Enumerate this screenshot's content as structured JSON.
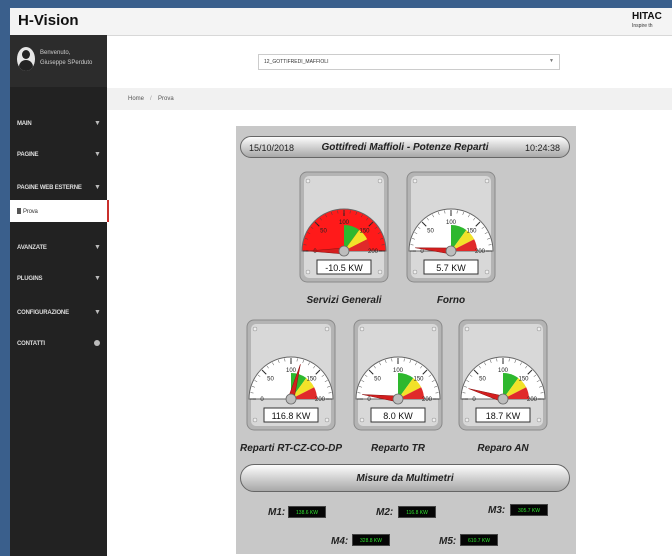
{
  "app": {
    "title": "H-Vision",
    "brand": "HITAC",
    "brand_sub": "Inspire th"
  },
  "user": {
    "greeting": "Benvenuto,",
    "name": "Giuseppe SPerduto"
  },
  "sidebar": {
    "items": [
      {
        "label": "MAIN",
        "icon": "chevron-down-icon"
      },
      {
        "label": "PAGINE",
        "icon": "chevron-down-icon"
      },
      {
        "label": "PAGINE WEB ESTERNE",
        "icon": "chevron-down-icon"
      },
      {
        "label": "Prova",
        "icon": "document-icon",
        "active": true
      },
      {
        "label": "AVANZATE",
        "icon": "chevron-down-icon"
      },
      {
        "label": "PLUGINS",
        "icon": "chevron-down-icon"
      },
      {
        "label": "CONFIGURAZIONE",
        "icon": "chevron-down-icon"
      },
      {
        "label": "CONTATTI",
        "icon": "globe-icon"
      }
    ]
  },
  "selector": {
    "value": "12_GOTTIFREDI_MAFFIOLI"
  },
  "breadcrumb": {
    "home": "Home",
    "sep": "/",
    "current": "Prova"
  },
  "header": {
    "date": "15/10/2018",
    "title": "Gottifredi Maffioli - Potenze Reparti",
    "time": "10:24:38"
  },
  "gauges": [
    {
      "label": "Servizi Generali",
      "value": -10.5,
      "display": "-10.5 KW",
      "min": 0,
      "max": 200,
      "ticks": [
        "0",
        "50",
        "100",
        "150",
        "200"
      ],
      "face": "#ff1a1a"
    },
    {
      "label": "Forno",
      "value": 5.7,
      "display": "5.7 KW",
      "min": 0,
      "max": 200,
      "ticks": [
        "0",
        "50",
        "100",
        "150",
        "200"
      ],
      "face": "#ffffff"
    },
    {
      "label": "Reparti RT-CZ-CO-DP",
      "value": 116.8,
      "display": "116.8 KW",
      "min": 0,
      "max": 200,
      "ticks": [
        "0",
        "50",
        "100",
        "150",
        "200"
      ],
      "face": "#ffffff"
    },
    {
      "label": "Reparto TR",
      "value": 8.0,
      "display": "8.0 KW",
      "min": 0,
      "max": 200,
      "ticks": [
        "0",
        "50",
        "100",
        "150",
        "200"
      ],
      "face": "#ffffff"
    },
    {
      "label": "Reparo AN",
      "value": 18.7,
      "display": "18.7 KW",
      "min": 0,
      "max": 200,
      "ticks": [
        "0",
        "50",
        "100",
        "150",
        "200"
      ],
      "face": "#ffffff"
    }
  ],
  "measures": {
    "title": "Misure da Multimetri",
    "items": [
      {
        "label": "M1:",
        "value": "138.6 KW"
      },
      {
        "label": "M2:",
        "value": "116.8 KW"
      },
      {
        "label": "M3:",
        "value": "305.7 KW"
      },
      {
        "label": "M4:",
        "value": "328.8 KW"
      },
      {
        "label": "M5:",
        "value": "610.7 KW"
      }
    ]
  },
  "colors": {
    "sidebar": "#222222",
    "accent": "#c9302c",
    "display_text": "#2ee02e",
    "panel": "#c8c8c8"
  }
}
